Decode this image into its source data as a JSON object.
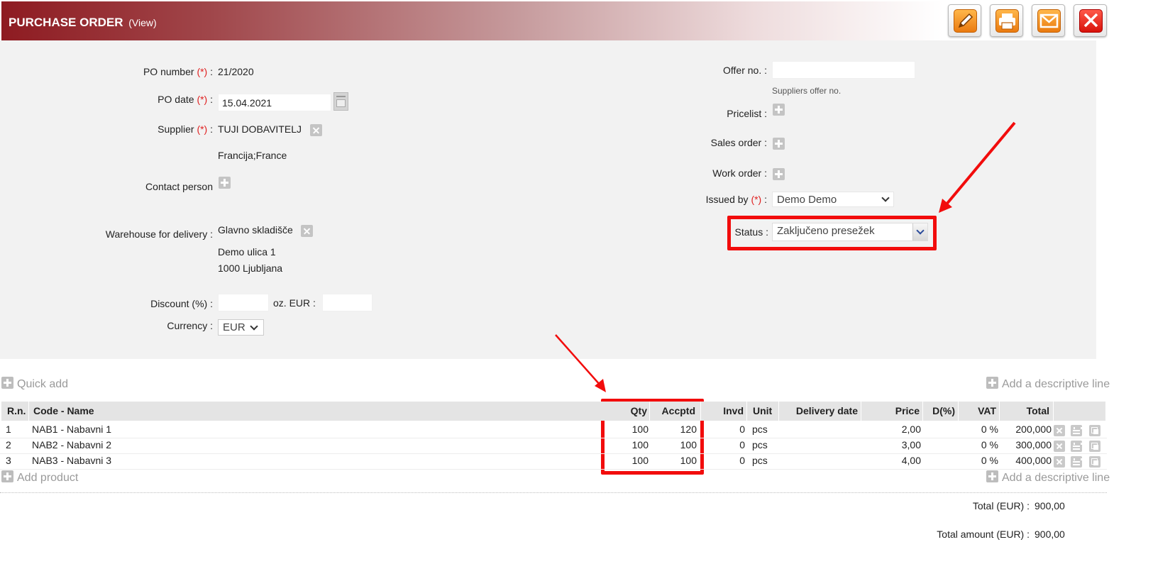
{
  "header": {
    "title": "PURCHASE ORDER",
    "subtitle": "(View)"
  },
  "toolbar": {
    "edit": "edit-icon",
    "print": "print-icon",
    "email": "email-icon",
    "close": "close-icon"
  },
  "form_left": {
    "po_number_label": "PO number",
    "po_number": "21/2020",
    "po_date_label": "PO date",
    "po_date": "15.04.2021",
    "supplier_label": "Supplier",
    "supplier": "TUJI DOBAVITELJ",
    "supplier_country": "Francija;France",
    "contact_label": "Contact person",
    "warehouse_label": "Warehouse for delivery :",
    "warehouse": "Glavno skladišče",
    "warehouse_street": "Demo ulica 1",
    "warehouse_city": "1000 Ljubljana",
    "discount_label": "Discount (%) :",
    "discount_eur_label": "oz. EUR :",
    "currency_label": "Currency :",
    "currency": "EUR",
    "required_mark": "(*)",
    "colon": ":"
  },
  "form_right": {
    "offer_label": "Offer no. :",
    "offer_hint": "Suppliers offer no.",
    "pricelist_label": "Pricelist :",
    "sales_order_label": "Sales order :",
    "work_order_label": "Work order :",
    "issued_by_label": "Issued by",
    "issued_by": "Demo Demo",
    "status_label": "Status :",
    "status": "Zaključeno presežek"
  },
  "actions": {
    "quick_add": "Quick add",
    "add_descriptive_line": "Add a descriptive line",
    "add_product": "Add product"
  },
  "table": {
    "headers": {
      "rn": "R.n.",
      "code": "Code - Name",
      "qty": "Qty",
      "accptd": "Accptd",
      "invd": "Invd",
      "unit": "Unit",
      "delivery": "Delivery date",
      "price": "Price",
      "disc": "D(%)",
      "vat": "VAT",
      "total": "Total"
    },
    "rows": [
      {
        "rn": "1",
        "code": "NAB1 - Nabavni 1",
        "qty": "100",
        "accptd": "120",
        "invd": "0",
        "unit": "pcs",
        "delivery": "",
        "price": "2,00",
        "disc": "",
        "vat": "0 %",
        "total": "200,000"
      },
      {
        "rn": "2",
        "code": "NAB2 - Nabavni 2",
        "qty": "100",
        "accptd": "100",
        "invd": "0",
        "unit": "pcs",
        "delivery": "",
        "price": "3,00",
        "disc": "",
        "vat": "0 %",
        "total": "300,000"
      },
      {
        "rn": "3",
        "code": "NAB3 - Nabavni 3",
        "qty": "100",
        "accptd": "100",
        "invd": "0",
        "unit": "pcs",
        "delivery": "",
        "price": "4,00",
        "disc": "",
        "vat": "0 %",
        "total": "400,000"
      }
    ]
  },
  "totals": {
    "total_label": "Total (EUR) :",
    "total": "900,00",
    "amount_label": "Total amount (EUR) :",
    "amount": "900,00"
  },
  "colors": {
    "brand": "#8e1b21",
    "highlight": "#f20c0c",
    "required": "#e02020"
  }
}
